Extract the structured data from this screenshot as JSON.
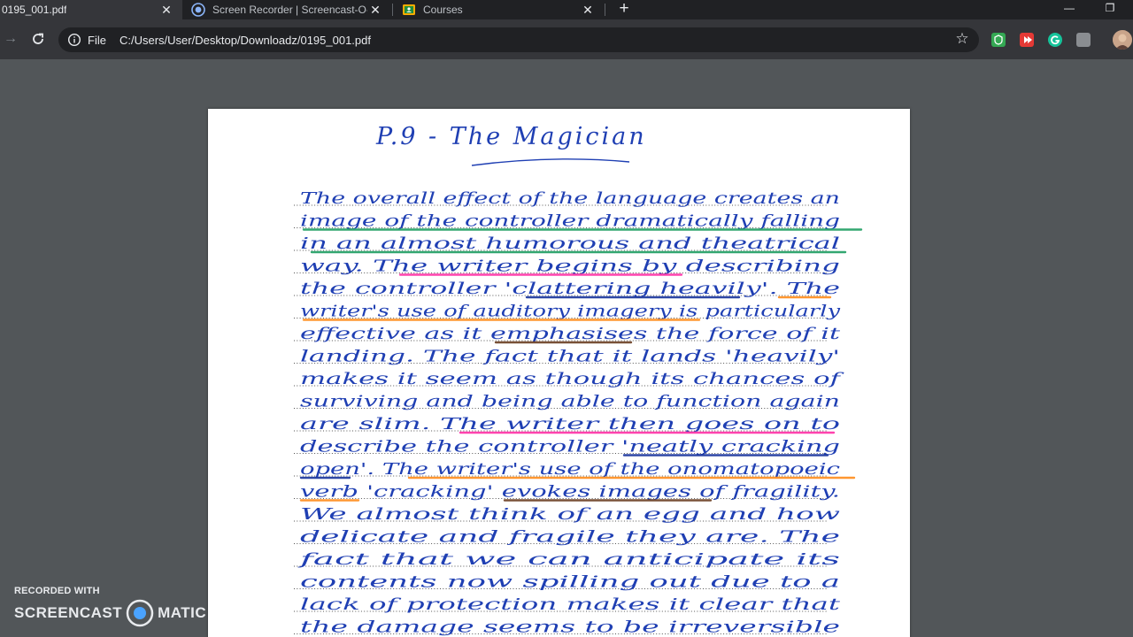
{
  "tabs": [
    {
      "title": "0195_001.pdf",
      "active": true
    },
    {
      "title": "Screen Recorder | Screencast-O-Matic",
      "active": false
    },
    {
      "title": "Courses",
      "active": false
    }
  ],
  "toolbar": {
    "scheme_label": "File",
    "url": "C:/Users/User/Desktop/Downloadz/0195_001.pdf"
  },
  "document": {
    "heading": "P.9 - The Magician",
    "lines": [
      "The overall effect of the language creates an",
      "image of the controller dramatically falling",
      "in an almost humorous and theatrical",
      "way. The writer begins by describing",
      "the controller 'clattering heavily'. The",
      "writer's use of auditory imagery is particularly",
      "effective as it emphasises the force of it",
      "landing. The fact that it lands 'heavily'",
      "makes it seem as though its chances of",
      "surviving and being able to function again",
      "are slim. The writer then goes on to",
      "describe the controller 'neatly cracking",
      "open'. The writer's use of the onomatopoeic",
      "verb 'cracking' evokes images of fragility.",
      "We almost think of an egg and how",
      "delicate and fragile they are. The",
      "fact that we can anticipate its",
      "contents now spilling out due to a",
      "lack of protection makes it clear that",
      "the damage seems to be irreversible"
    ]
  },
  "watermark": {
    "top_label": "RECORDED WITH",
    "brand_left": "SCREENCAST",
    "brand_right": "MATIC"
  },
  "colors": {
    "ink": "#1f3fb3",
    "green_highlight": "#1e9e62",
    "pink_highlight": "#ff2fa6",
    "orange_highlight": "#ff8c1a",
    "navy_highlight": "#17329c",
    "brown_highlight": "#6b3f22"
  }
}
